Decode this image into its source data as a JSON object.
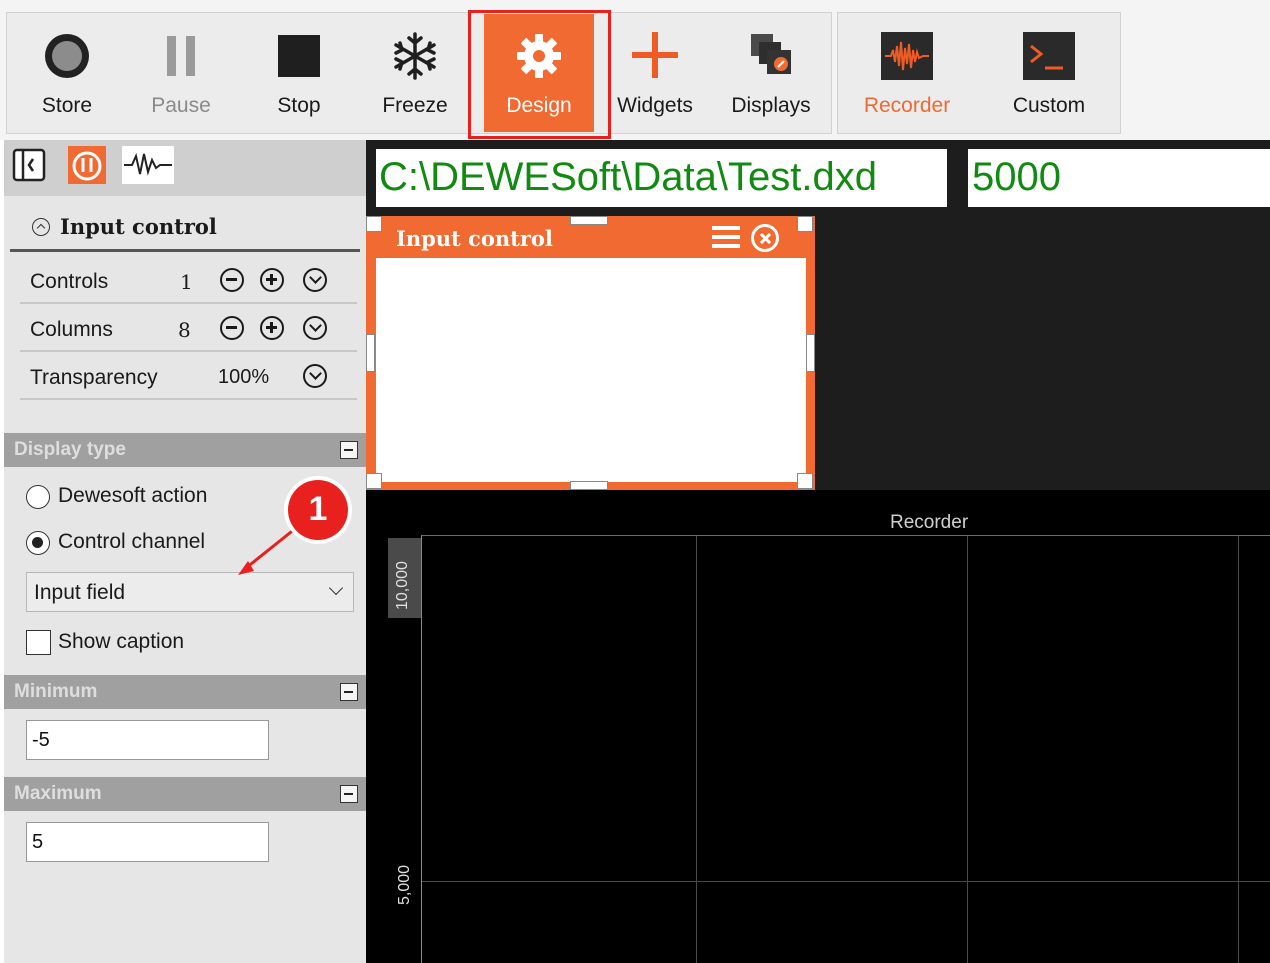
{
  "toolbar": {
    "buttons": [
      {
        "label": "Store",
        "icon": "record-circle-icon"
      },
      {
        "label": "Pause",
        "icon": "pause-icon",
        "state": "disabled"
      },
      {
        "label": "Stop",
        "icon": "stop-square-icon"
      },
      {
        "label": "Freeze",
        "icon": "snowflake-icon"
      },
      {
        "label": "Design",
        "icon": "gear-icon",
        "state": "active"
      },
      {
        "label": "Widgets",
        "icon": "plus-icon"
      },
      {
        "label": "Displays",
        "icon": "displays-icon"
      },
      {
        "label": "Recorder",
        "icon": "waveform-icon",
        "state": "current-display"
      },
      {
        "label": "Custom",
        "icon": "terminal-icon"
      }
    ]
  },
  "left_panel": {
    "header_title": "Input control",
    "rows": [
      {
        "label": "Controls",
        "value": "1"
      },
      {
        "label": "Columns",
        "value": "8"
      },
      {
        "label": "Transparency",
        "value": "100%"
      }
    ],
    "display_type": {
      "title": "Display type",
      "options": [
        "Dewesoft action",
        "Control channel"
      ],
      "selected": "Control channel",
      "dropdown_value": "Input field",
      "show_caption_label": "Show caption",
      "show_caption_checked": false
    },
    "minimum": {
      "title": "Minimum",
      "value": "-5"
    },
    "maximum": {
      "title": "Maximum",
      "value": "5"
    }
  },
  "canvas": {
    "file_path": "C:\\DEWESoft\\Data\\Test.dxd",
    "value_display": "5000",
    "widget_title": "Input control",
    "recorder_title": "Recorder",
    "y_labels": [
      "10,000",
      "5,000"
    ]
  },
  "annotation": {
    "badge": "1"
  },
  "colors": {
    "accent": "#f16a31",
    "highlight": "#e8201e",
    "value_text": "#118a11",
    "canvas_bg": "#000000"
  }
}
